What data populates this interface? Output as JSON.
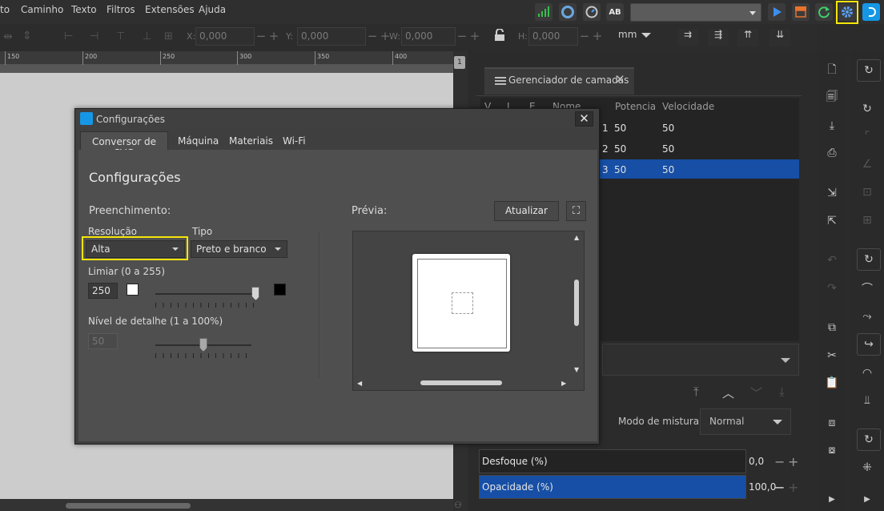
{
  "menu": {
    "items": [
      "to",
      "Caminho",
      "Texto",
      "Filtros",
      "Extensões",
      "Ajuda"
    ]
  },
  "toolbar": {
    "ab_label": "AB",
    "x_label": "X:",
    "x_value": "0,000",
    "y_label": "Y:",
    "y_value": "0,000",
    "w_label": "W:",
    "w_value": "0,000",
    "h_label": "H:",
    "h_value": "0,000",
    "unit": "mm"
  },
  "ruler": {
    "ticks": [
      "150",
      "200",
      "250",
      "300",
      "350",
      "400"
    ]
  },
  "layers_panel": {
    "tab_label": "Gerenciador de camadas",
    "columns": [
      "V",
      "L",
      "E",
      "Nome",
      "Potencia",
      "Velocidade"
    ],
    "rows": [
      {
        "id": "1",
        "potencia": "50",
        "velocidade": "50"
      },
      {
        "id": "2",
        "potencia": "50",
        "velocidade": "50"
      },
      {
        "id": "3",
        "potencia": "50",
        "velocidade": "50"
      }
    ],
    "selected_row": 3,
    "blend_mode_label": "Modo de mistura:",
    "blend_mode_value": "Normal",
    "blur_label": "Desfoque (%)",
    "blur_value": "0,0",
    "opacity_label": "Opacidade (%)",
    "opacity_value": "100,0"
  },
  "dialog": {
    "title": "Configurações",
    "tabs": [
      "Conversor de SVG",
      "Máquina",
      "Materiais",
      "Wi-Fi"
    ],
    "active_tab": "Conversor de SVG",
    "heading": "Configurações",
    "fill_label": "Preenchimento:",
    "resolution_label": "Resolução",
    "resolution_value": "Alta",
    "type_label": "Tipo",
    "type_value": "Preto e branco",
    "threshold_label": "Limiar (0 a 255)",
    "threshold_value": "250",
    "threshold_level": 0.98,
    "detail_label": "Nível de detalhe (1 a 100%)",
    "detail_value": "50",
    "detail_level": 0.5,
    "preview_label": "Prévia:",
    "update_button": "Atualizar"
  },
  "colors": {
    "accent": "#164fa5",
    "highlight": "#f5e60a",
    "brand": "#1597e5"
  }
}
